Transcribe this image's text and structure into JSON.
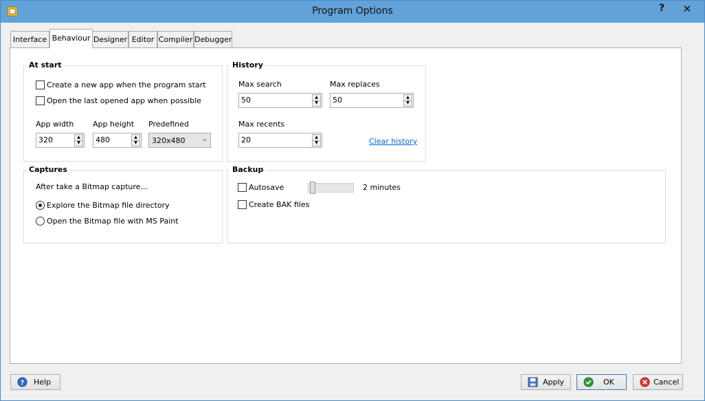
{
  "window": {
    "title": "Program Options"
  },
  "titlebar": {
    "help_glyph": "?",
    "close_glyph": "✕"
  },
  "tabs": [
    {
      "label": "Interface"
    },
    {
      "label": "Behaviour"
    },
    {
      "label": "Designer"
    },
    {
      "label": "Editor"
    },
    {
      "label": "Compiler"
    },
    {
      "label": "Debugger"
    }
  ],
  "active_tab": "Behaviour",
  "at_start": {
    "title": "At start",
    "create_new_app": {
      "label": "Create a new app when the program start",
      "checked": false
    },
    "open_last": {
      "label": "Open the last opened app when possible",
      "checked": false
    },
    "app_width": {
      "label": "App width",
      "value": "320"
    },
    "app_height": {
      "label": "App height",
      "value": "480"
    },
    "predefined": {
      "label": "Predefined",
      "value": "320x480"
    }
  },
  "history": {
    "title": "History",
    "max_search": {
      "label": "Max search",
      "value": "50"
    },
    "max_replaces": {
      "label": "Max replaces",
      "value": "50"
    },
    "max_recents": {
      "label": "Max recents",
      "value": "20"
    },
    "clear_history": "Clear history"
  },
  "captures": {
    "title": "Captures",
    "prompt": "After take a Bitmap capture...",
    "explore": {
      "label": "Explore the Bitmap file directory",
      "selected": true
    },
    "open_paint": {
      "label": "Open the Bitmap file with MS Paint",
      "selected": false
    }
  },
  "backup": {
    "title": "Backup",
    "autosave": {
      "label": "Autosave",
      "checked": false
    },
    "interval_text": "2 minutes",
    "interval_slider_level": 0,
    "create_bak": {
      "label": "Create BAK files",
      "checked": false
    }
  },
  "buttons": {
    "help": "Help",
    "apply": "Apply",
    "ok": "OK",
    "cancel": "Cancel"
  },
  "colors": {
    "titlebar": "#63a2d8",
    "link": "#0066cc",
    "ok_green": "#2e9b3a",
    "cancel_red": "#d33a2f",
    "help_blue": "#2b6cc4"
  }
}
